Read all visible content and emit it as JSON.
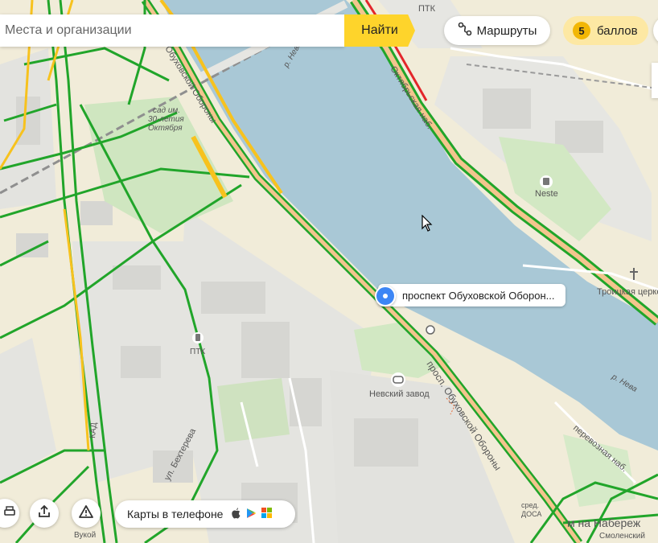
{
  "search": {
    "placeholder": "Места и организации",
    "find_label": "Найти"
  },
  "routes": {
    "label": "Маршруты",
    "icon": "route-icon"
  },
  "points": {
    "count": "5",
    "label": "баллов"
  },
  "app_promo": {
    "label": "Карты в телефоне",
    "icons": [
      "apple-icon",
      "google-play-icon",
      "windows-icon"
    ]
  },
  "bottom_controls": {
    "icons": [
      "print-icon",
      "share-icon",
      "warning-icon"
    ]
  },
  "popup": {
    "label": "проспект Обуховской Оборон..."
  },
  "map_labels": {
    "ptk_top": "ПТК",
    "neva_1": "р. Нева",
    "neva_2": "р. Нева",
    "garden": "сад им.\n30-летия\nОктября",
    "garden_l1": "сад им.",
    "garden_l2": "30-летия",
    "garden_l3": "Октября",
    "obukhovskoy_top": "Обуховской Обороны",
    "oktyabrskaya": "Октябрьская наб.",
    "neste": "Neste",
    "troitskaya": "Троицкая церко",
    "ptk_mid": "ПТК",
    "nevsky_zavod": "Невский завод",
    "obukhovskoy_bottom": "просп. Обуховской Обороны",
    "perevoznaya": "перевозная наб.",
    "bekhtereva": "ул. Бехтерева",
    "kad": "КАД",
    "naberezh": "м на Набереж",
    "smolensky": "Смоленский",
    "doska": "ДОСА",
    "sred": "сред.",
    "vukoi": "Вукой"
  }
}
